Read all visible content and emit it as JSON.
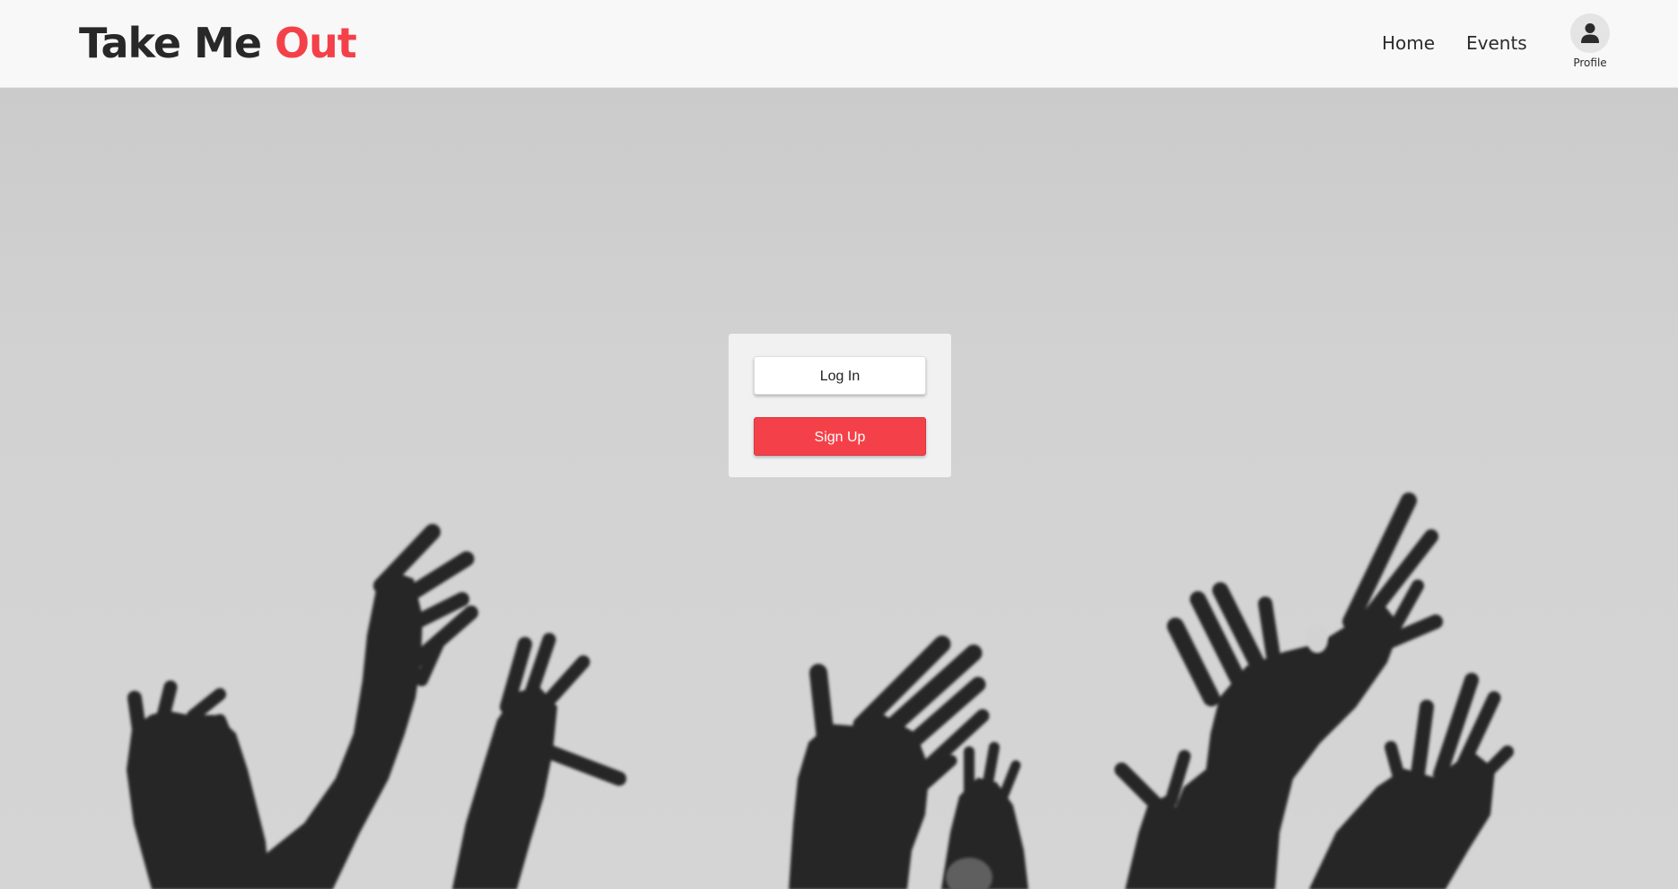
{
  "brand": {
    "title_main": "Take Me ",
    "title_accent": "Out",
    "accent_color": "#f44149"
  },
  "nav": {
    "links": [
      {
        "label": "Home"
      },
      {
        "label": "Events"
      }
    ],
    "profile": {
      "label": "Profile",
      "icon": "person-icon"
    }
  },
  "hero": {
    "image": "raised-hands-silhouette"
  },
  "auth": {
    "login_label": "Log In",
    "signup_label": "Sign Up",
    "signup_color": "#f44149"
  }
}
